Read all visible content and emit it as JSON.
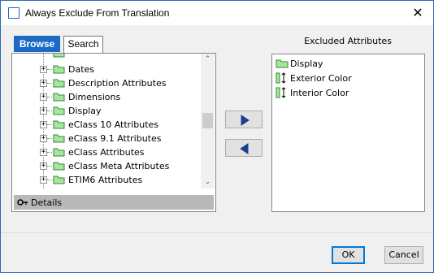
{
  "window": {
    "title": "Always Exclude From Translation",
    "close_glyph": "✕"
  },
  "tabs": [
    {
      "label": "Browse",
      "active": true
    },
    {
      "label": "Search",
      "active": false
    }
  ],
  "tree": {
    "items": [
      {
        "label": "Dates"
      },
      {
        "label": "Description Attributes"
      },
      {
        "label": "Dimensions"
      },
      {
        "label": "Display"
      },
      {
        "label": "eClass 10 Attributes"
      },
      {
        "label": "eClass 9.1 Attributes"
      },
      {
        "label": "eClass Attributes"
      },
      {
        "label": "eClass Meta Attributes"
      },
      {
        "label": "ETIM6 Attributes"
      }
    ],
    "expander_glyph": "+",
    "scroll_up_glyph": "⌃",
    "scroll_down_glyph": "⌄"
  },
  "details": {
    "label": "Details"
  },
  "excluded": {
    "title": "Excluded Attributes",
    "items": [
      {
        "label": "Display",
        "icon": "folder-icon"
      },
      {
        "label": "Exterior Color",
        "icon": "attribute-icon"
      },
      {
        "label": "Interior Color",
        "icon": "attribute-icon"
      }
    ]
  },
  "buttons": {
    "ok": "OK",
    "cancel": "Cancel"
  },
  "colors": {
    "accent": "#1c6ac6",
    "folder_fill": "#a8e6a0",
    "folder_stroke": "#2f8a2f"
  }
}
